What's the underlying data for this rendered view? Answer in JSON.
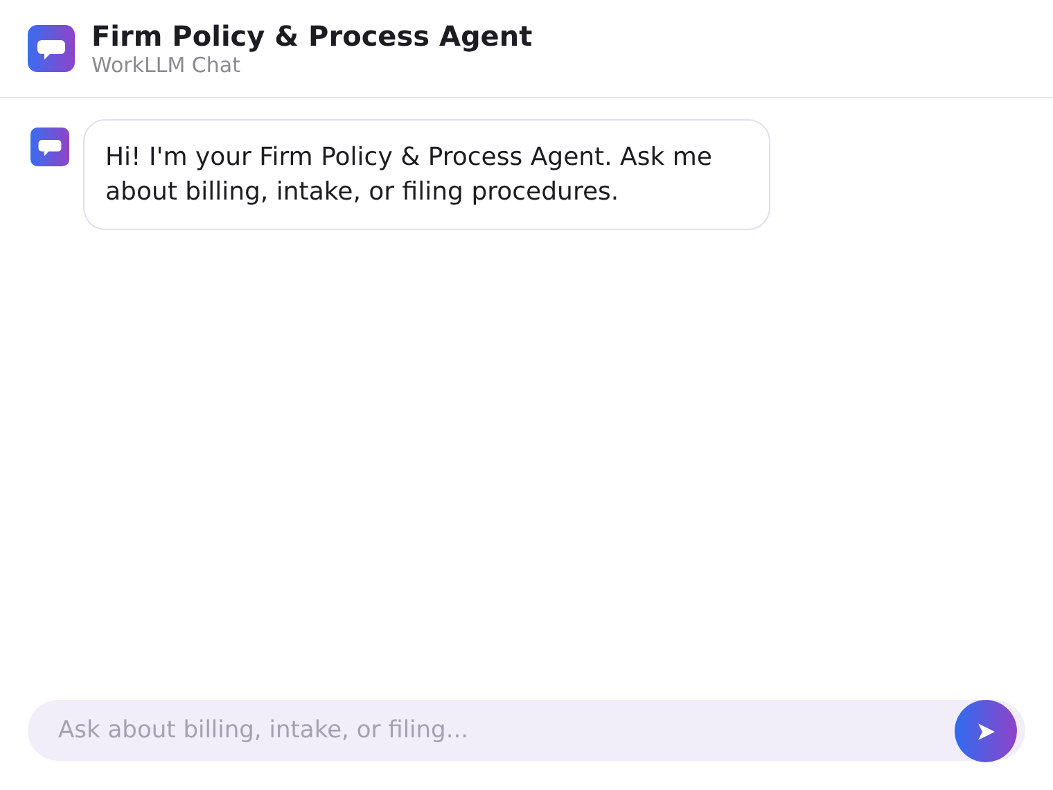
{
  "header": {
    "title": "Firm Policy & Process Agent",
    "subtitle": "WorkLLM Chat"
  },
  "messages": [
    {
      "kind": "agent",
      "text": "Hi! I'm your Firm Policy & Process Agent. Ask me about billing, intake, or filing procedures."
    }
  ],
  "composer": {
    "placeholder": "Ask about billing, intake, or filing..."
  }
}
